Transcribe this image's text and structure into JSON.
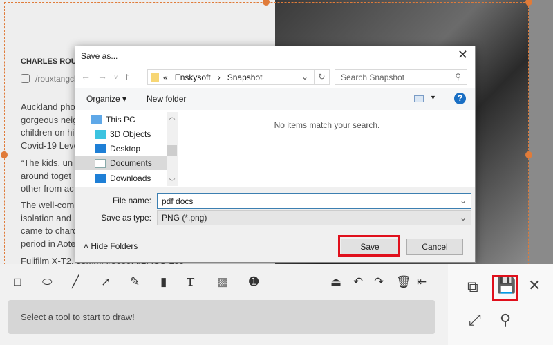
{
  "article": {
    "author": "CHARLES ROU",
    "handle": "/rouxtangcl",
    "paras": [
      "Auckland pho\ngorgeous neig\nchildren on hi\nCovid-19 Leve",
      "“The kids, un\naround toget\nother from ac",
      "The well-com\nisolation and\ncame to chard\nperiod in Aote"
    ],
    "caption": "Fuiifilm X-T2. 35mm. f/5000. f/2. ISO 200"
  },
  "dialog": {
    "title": "Save as...",
    "breadcrumb": [
      "«",
      "Enskysoft",
      "›",
      "Snapshot",
      "›"
    ],
    "search_placeholder": "Search Snapshot",
    "organize": "Organize ▾",
    "new_folder": "New folder",
    "empty_message": "No items match your search.",
    "tree": [
      "This PC",
      "3D Objects",
      "Desktop",
      "Documents",
      "Downloads"
    ],
    "file_name_label": "File name:",
    "file_name_value": "pdf docs",
    "save_type_label": "Save as type:",
    "save_type_value": "PNG (*.png)",
    "hide_folders": "Hide Folders",
    "save": "Save",
    "cancel": "Cancel"
  },
  "toolbar": {
    "status": "Select a tool to start to draw!",
    "tools": [
      "rectangle-icon",
      "ellipse-icon",
      "line-icon",
      "arrow-icon",
      "pencil-icon",
      "marker-icon",
      "text-icon",
      "mosaic-icon",
      "step-number-icon",
      "eraser-icon",
      "undo-icon",
      "redo-icon",
      "trash-icon",
      "exit-icon"
    ]
  },
  "right_panel": {
    "icons": [
      "copy-icon",
      "save-icon",
      "close-icon",
      "expand-icon",
      "pin-icon"
    ]
  },
  "colors": {
    "accent": "#e07b39",
    "highlight": "#e0101c",
    "help": "#1a6fc4"
  }
}
